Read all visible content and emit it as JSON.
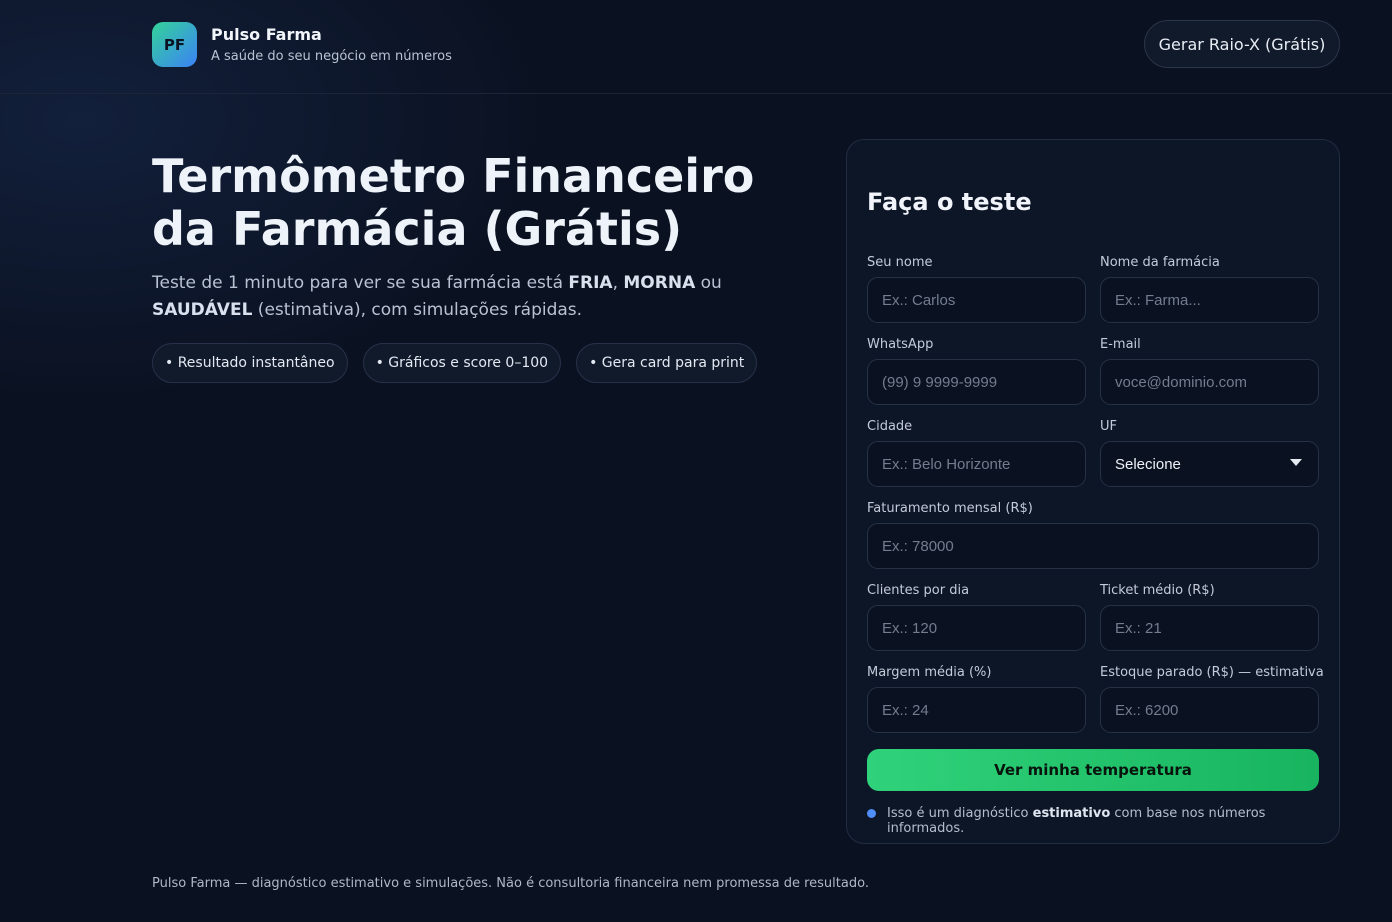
{
  "header": {
    "logo_initials": "PF",
    "brand_name": "Pulso Farma",
    "tagline": "A saúde do seu negócio em números",
    "cta_label": "Gerar Raio-X (Grátis)"
  },
  "hero": {
    "title": "Termômetro Financeiro da Farmácia (Grátis)",
    "subtitle": {
      "part1": "Teste de 1 minuto para ver se sua farmácia está ",
      "fria": "FRIA",
      "sep1": ", ",
      "morna": "MORNA",
      "sep2": " ou ",
      "saudavel": "SAUDÁVEL",
      "part2": " (estimativa), com simulações rápidas."
    },
    "pills": [
      "• Resultado instantâneo",
      "• Gráficos e score 0–100",
      "• Gera card para print"
    ]
  },
  "form": {
    "title": "Faça o teste",
    "fields": {
      "name": {
        "label": "Seu nome",
        "placeholder": "Ex.: Carlos",
        "value": ""
      },
      "pharmacy": {
        "label": "Nome da farmácia",
        "placeholder": "Ex.: Farma...",
        "value": ""
      },
      "whatsapp": {
        "label": "WhatsApp",
        "placeholder": "(99) 9 9999-9999",
        "value": ""
      },
      "email": {
        "label": "E-mail",
        "placeholder": "voce@dominio.com",
        "value": ""
      },
      "city": {
        "label": "Cidade",
        "placeholder": "Ex.: Belo Horizonte",
        "value": ""
      },
      "uf": {
        "label": "UF",
        "selected": "Selecione"
      },
      "revenue": {
        "label": "Faturamento mensal (R$)",
        "placeholder": "Ex.: 78000",
        "value": ""
      },
      "clients": {
        "label": "Clientes por dia",
        "placeholder": "Ex.: 120",
        "value": ""
      },
      "ticket": {
        "label": "Ticket médio (R$)",
        "placeholder": "Ex.: 21",
        "value": ""
      },
      "margin": {
        "label": "Margem média (%)",
        "placeholder": "Ex.: 24",
        "value": ""
      },
      "stock": {
        "label": "Estoque parado (R$) — estimativa",
        "placeholder": "Ex.: 6200",
        "value": ""
      }
    },
    "submit_label": "Ver minha temperatura",
    "note": {
      "part1": "Isso é um diagnóstico ",
      "bold": "estimativo",
      "part2": " com base nos números informados."
    }
  },
  "footer": {
    "text": "Pulso Farma — diagnóstico estimativo e simulações. Não é consultoria financeira nem promessa de resultado."
  },
  "colors": {
    "background": "#0a1120",
    "card": "#0d1627",
    "accent_green": "#22c56b",
    "accent_blue": "#4f8ef7"
  }
}
